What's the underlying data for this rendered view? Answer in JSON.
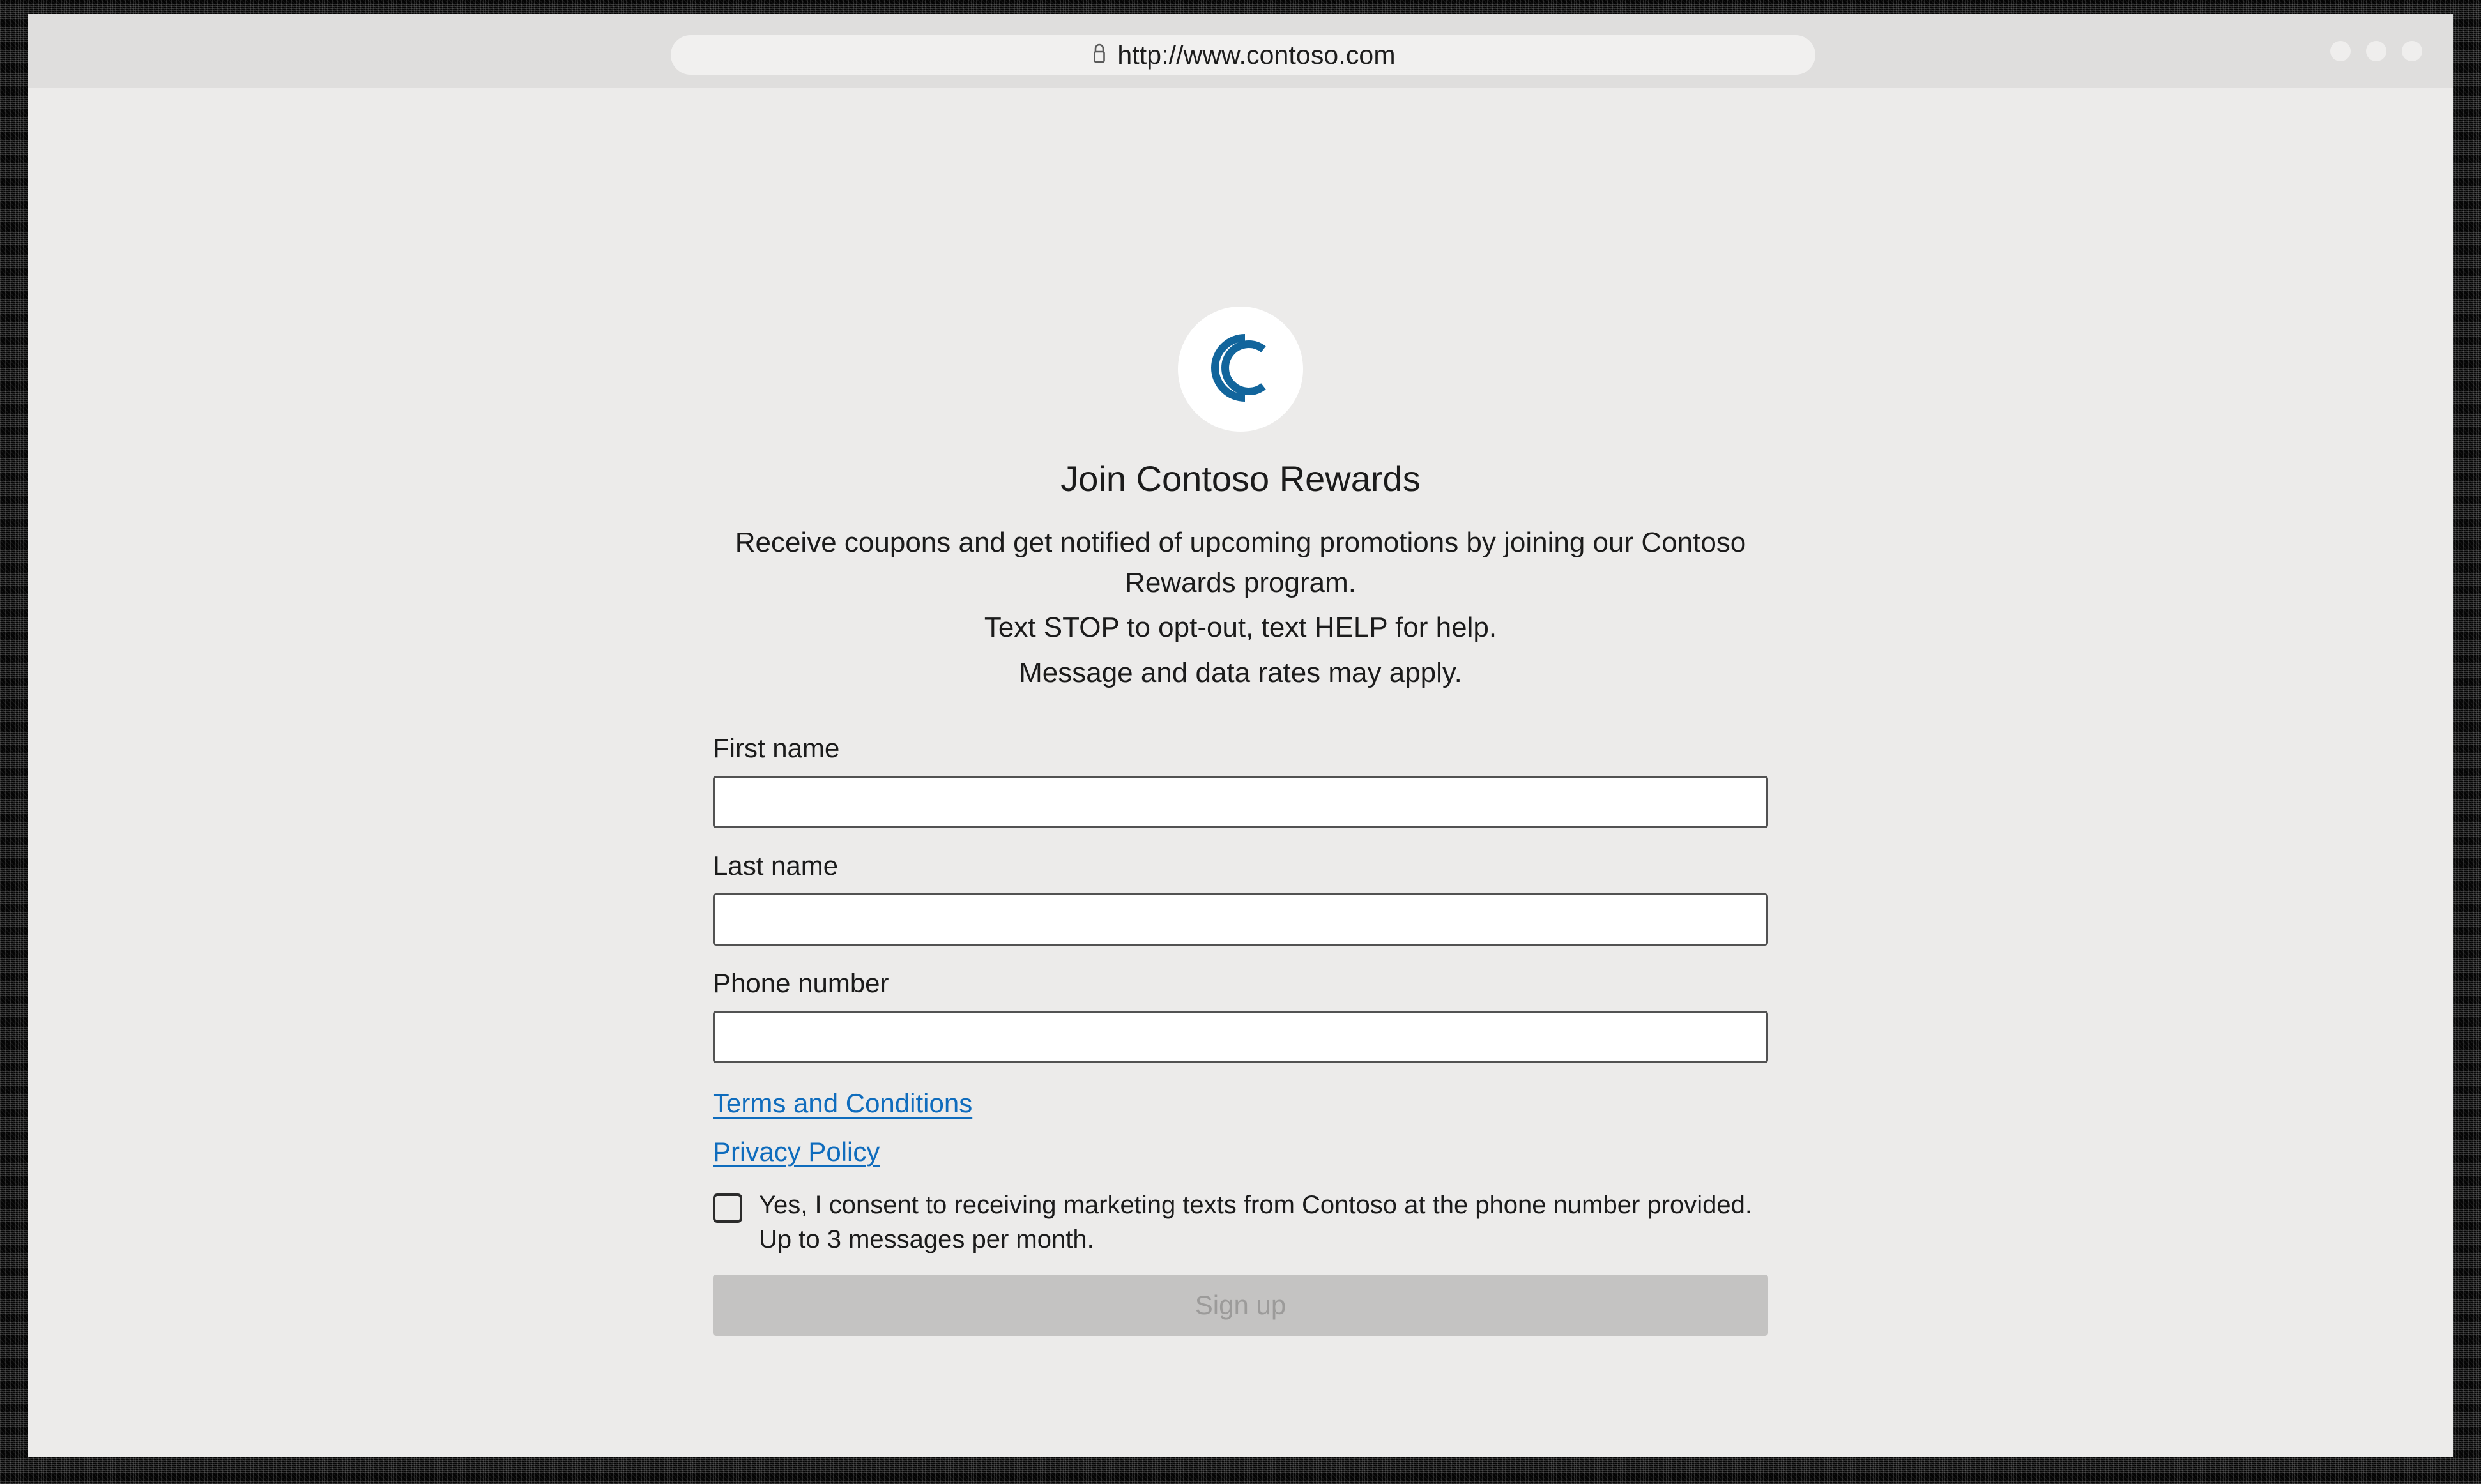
{
  "browser": {
    "url": "http://www.contoso.com",
    "lock_icon": "lock-icon",
    "window_controls": [
      "minimize-dot",
      "maximize-dot",
      "close-dot"
    ]
  },
  "page": {
    "logo": {
      "icon": "contoso-double-c-logo",
      "color": "#12659c",
      "background": "#ffffff"
    },
    "headline": "Join Contoso Rewards",
    "intro": "Receive coupons and get notified of upcoming promotions by joining our Contoso Rewards program.",
    "stop_line": "Text STOP to opt-out, text HELP for help.",
    "rates_line": "Message and data rates may apply.",
    "form": {
      "fields": [
        {
          "label": "First name",
          "value": "",
          "placeholder": ""
        },
        {
          "label": "Last name",
          "value": "",
          "placeholder": ""
        },
        {
          "label": "Phone number",
          "value": "",
          "placeholder": ""
        }
      ],
      "terms_link": "Terms and Conditions",
      "privacy_link": "Privacy Policy",
      "consent_text": "Yes, I consent to receiving marketing texts from Contoso at the phone number provided. Up to 3 messages per month.",
      "consent_checked": false,
      "submit_label": "Sign up",
      "submit_disabled": true
    }
  },
  "colors": {
    "link": "#0f6cbd",
    "brand": "#12659c",
    "page_bg": "#ecebea",
    "chrome_bg": "#dfdedd",
    "button_disabled_bg": "#c4c3c2",
    "button_disabled_text": "#9c9b9a"
  }
}
